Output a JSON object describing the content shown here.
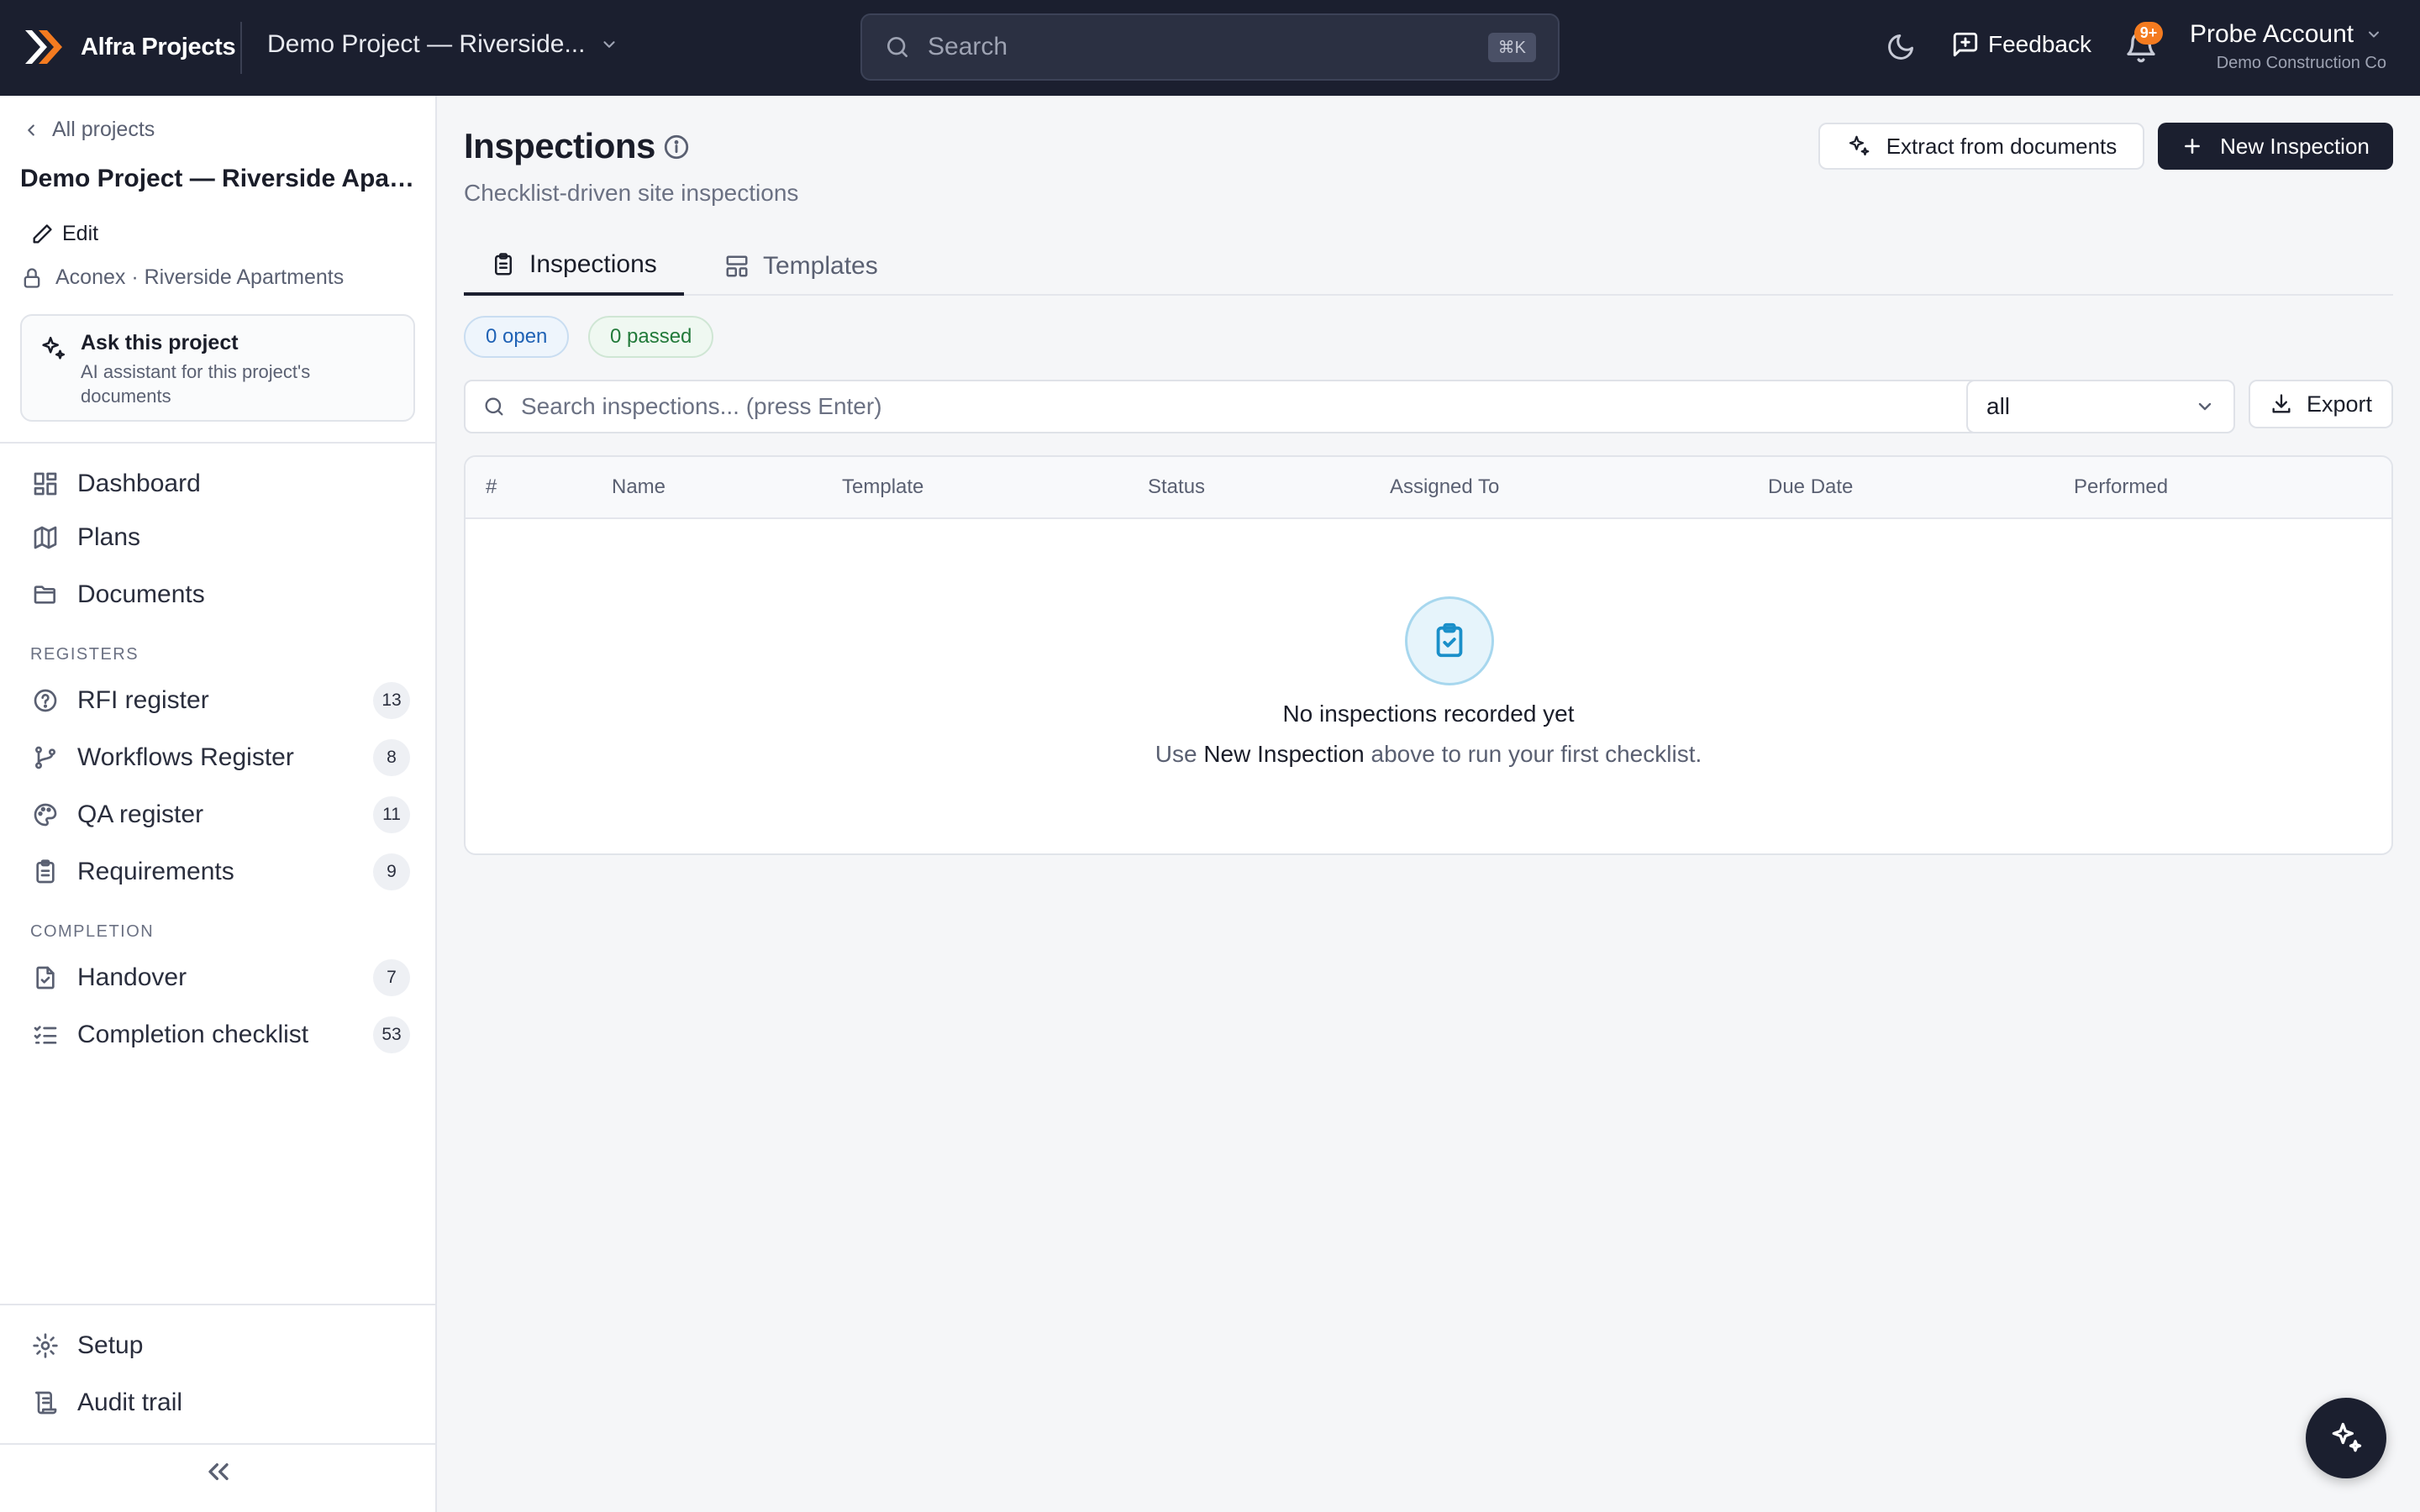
{
  "topbar": {
    "brand": "Alfra Projects",
    "project_switch": "Demo Project — Riverside...",
    "search_placeholder": "Search",
    "search_shortcut": "⌘K",
    "feedback": "Feedback",
    "notifications_badge": "9+",
    "account_name": "Probe Account",
    "account_org": "Demo Construction Co"
  },
  "sidebar": {
    "back": "All projects",
    "project_name": "Demo Project — Riverside Apart...",
    "edit": "Edit",
    "source": "Aconex · Riverside Apartments",
    "ask_title": "Ask this project",
    "ask_sub": "AI assistant for this project's documents",
    "nav": [
      {
        "label": "Dashboard",
        "icon": "dashboard-icon"
      },
      {
        "label": "Plans",
        "icon": "map-icon"
      },
      {
        "label": "Documents",
        "icon": "folder-icon"
      }
    ],
    "registers_title": "REGISTERS",
    "registers": [
      {
        "label": "RFI register",
        "count": "13",
        "icon": "help-circle-icon"
      },
      {
        "label": "Workflows Register",
        "count": "8",
        "icon": "git-branch-icon"
      },
      {
        "label": "QA register",
        "count": "11",
        "icon": "palette-icon"
      },
      {
        "label": "Requirements",
        "count": "9",
        "icon": "clipboard-list-icon"
      }
    ],
    "completion_title": "COMPLETION",
    "completion": [
      {
        "label": "Handover",
        "count": "7",
        "icon": "file-check-icon"
      },
      {
        "label": "Completion checklist",
        "count": "53",
        "icon": "list-checks-icon"
      }
    ],
    "footer": [
      {
        "label": "Setup",
        "icon": "gear-icon"
      },
      {
        "label": "Audit trail",
        "icon": "scroll-icon"
      }
    ]
  },
  "main": {
    "title": "Inspections",
    "subtitle": "Checklist-driven site inspections",
    "extract_button": "Extract from documents",
    "new_button": "New Inspection",
    "tabs": [
      {
        "label": "Inspections",
        "active": true
      },
      {
        "label": "Templates",
        "active": false
      }
    ],
    "pills": {
      "open": "0 open",
      "passed": "0 passed"
    },
    "search_placeholder": "Search inspections... (press Enter)",
    "status_filter": "all",
    "export_button": "Export",
    "columns": [
      "#",
      "Name",
      "Template",
      "Status",
      "Assigned To",
      "Due Date",
      "Performed"
    ],
    "empty_title": "No inspections recorded yet",
    "empty_sub_before": "Use ",
    "empty_sub_bold": "New Inspection",
    "empty_sub_after": " above to run your first checklist."
  },
  "colors": {
    "topbar_bg": "#1b1f2f",
    "accent_orange": "#f47b20",
    "open_pill": "#1f62b5",
    "passed_pill": "#227a3a",
    "empty_icon": "#1a8fc9"
  }
}
